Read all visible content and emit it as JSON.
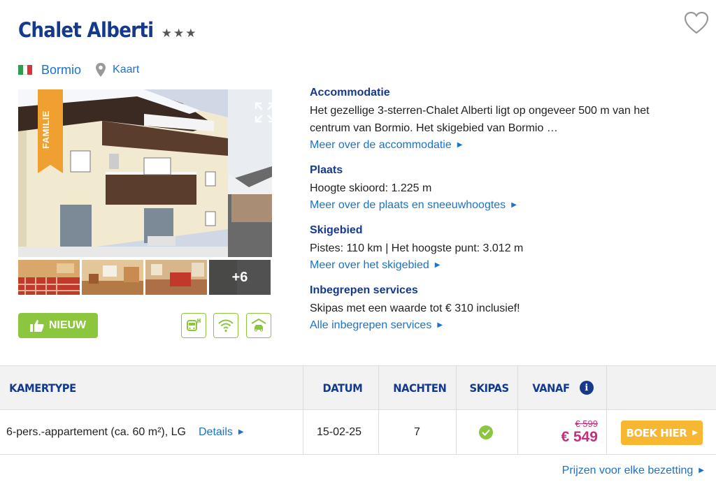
{
  "hotel": {
    "name": "Chalet Alberti",
    "stars": "★★★",
    "town": "Bormio",
    "map_label": "Kaart",
    "badge": "FAMILIE",
    "more_photos": "+6",
    "new_label": "NIEUW"
  },
  "colors": {
    "primary": "#153a8c",
    "link": "#1a73c8",
    "accent_green": "#8cc63f",
    "badge_orange": "#f0a030",
    "price": "#c3307b",
    "book": "#f7b731"
  },
  "amenities": [
    "ski-bus-icon",
    "wifi-icon",
    "garage-icon"
  ],
  "sections": [
    {
      "title": "Accommodatie",
      "text": "Het gezellige 3-sterren-Chalet Alberti ligt op ongeveer 500 m van het centrum van Bormio. Het skigebied van Bormio …",
      "link": "Meer over de accommodatie"
    },
    {
      "title": "Plaats",
      "text": "Hoogte skioord: 1.225 m",
      "link": "Meer over de plaats en sneeuwhoogtes"
    },
    {
      "title": "Skigebied",
      "text": "Pistes: 110 km | Het hoogste punt: 3.012 m",
      "link": "Meer over het skigebied"
    },
    {
      "title": "Inbegrepen services",
      "text": "Skipas met een waarde tot € 310 inclusief!",
      "link": "Alle inbegrepen services"
    }
  ],
  "table": {
    "headers": {
      "room": "KAMERTYPE",
      "date": "DATUM",
      "nights": "NACHTEN",
      "skipass": "SKIPAS",
      "from": "VANAF"
    },
    "row": {
      "room": "6-pers.-appartement (ca. 60 m²), LG",
      "details": "Details",
      "date": "15-02-25",
      "nights": "7",
      "price_old": "€ 599",
      "price_new": "€ 549",
      "book": "BOEK HIER"
    }
  },
  "footer_link": "Prijzen voor elke bezetting"
}
